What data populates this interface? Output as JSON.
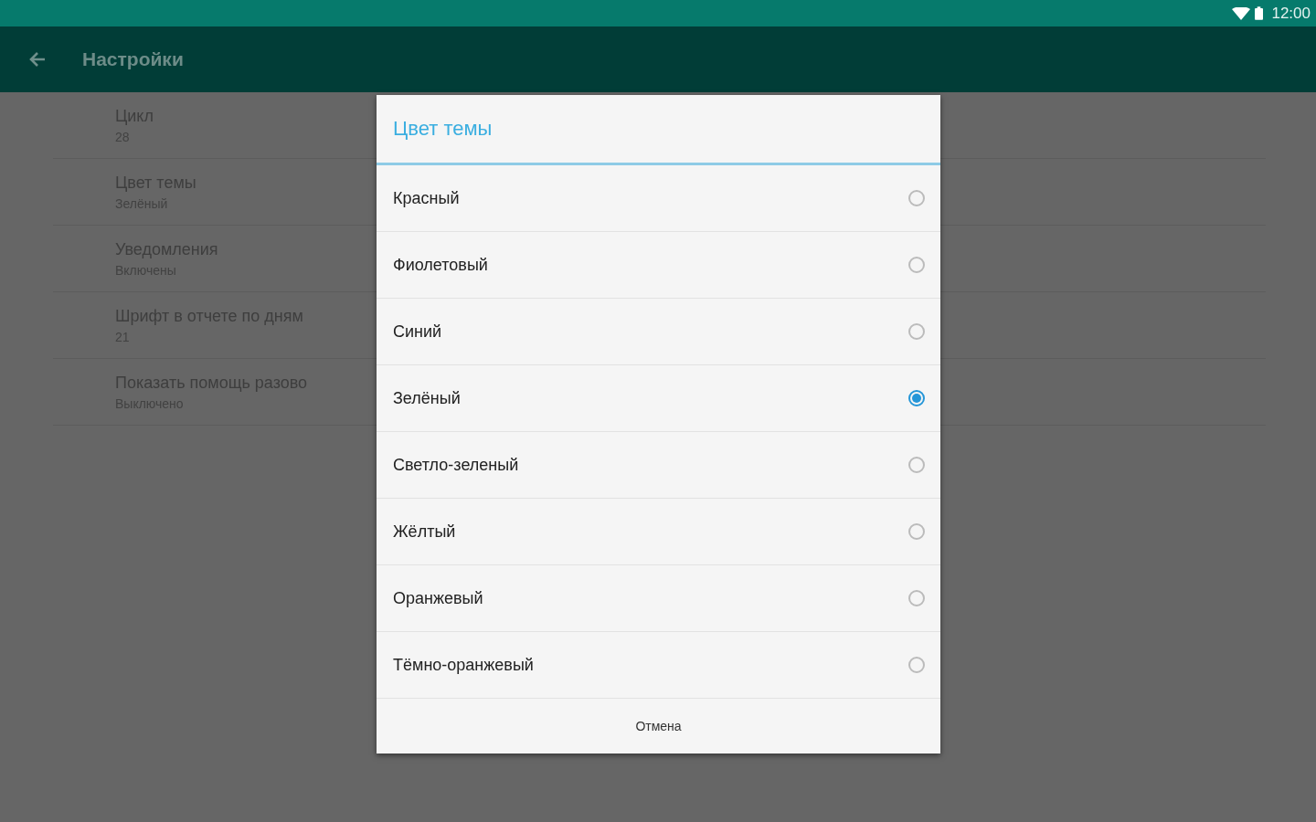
{
  "status_bar": {
    "time": "12:00"
  },
  "toolbar": {
    "title": "Настройки"
  },
  "settings": [
    {
      "title": "Цикл",
      "summary": "28"
    },
    {
      "title": "Цвет темы",
      "summary": "Зелёный"
    },
    {
      "title": "Уведомления",
      "summary": "Включены"
    },
    {
      "title": "Шрифт в отчете по дням",
      "summary": "21"
    },
    {
      "title": "Показать помощь разово",
      "summary": "Выключено"
    }
  ],
  "dialog": {
    "title": "Цвет темы",
    "options": [
      {
        "label": "Красный",
        "selected": false
      },
      {
        "label": "Фиолетовый",
        "selected": false
      },
      {
        "label": "Синий",
        "selected": false
      },
      {
        "label": "Зелёный",
        "selected": true
      },
      {
        "label": "Светло-зеленый",
        "selected": false
      },
      {
        "label": "Жёлтый",
        "selected": false
      },
      {
        "label": "Оранжевый",
        "selected": false
      },
      {
        "label": "Тёмно-оранжевый",
        "selected": false
      }
    ],
    "button": "Отмена"
  }
}
